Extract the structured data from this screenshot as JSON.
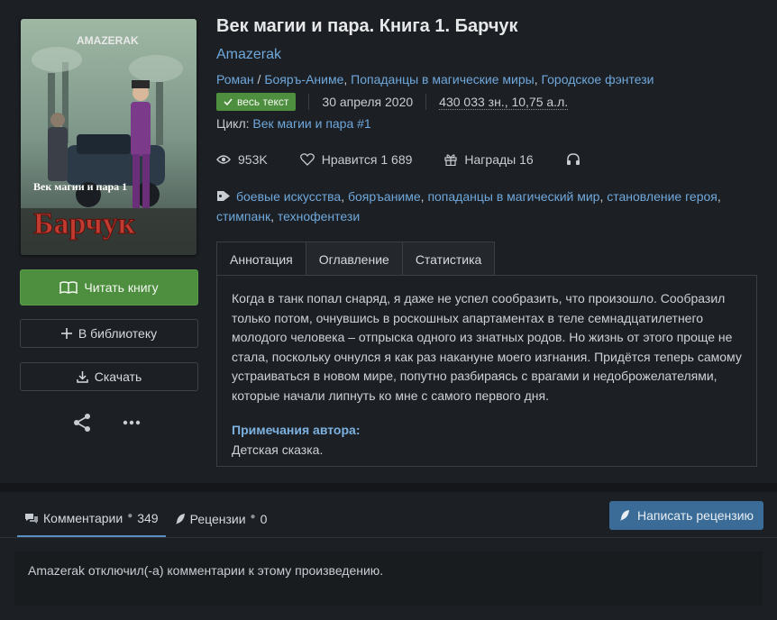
{
  "book": {
    "title": "Век магии и пара. Книга 1. Барчук",
    "author": "Amazerak",
    "genre_main": "Роман",
    "genre_slash": " / ",
    "genres": [
      "Бояръ-Аниме",
      "Попаданцы в магические миры",
      "Городское фэнтези"
    ],
    "status_badge": "весь текст",
    "date": "30 апреля 2020",
    "size": "430 033 зн., 10,75 а.л.",
    "cycle_label": "Цикл: ",
    "cycle": "Век магии и пара #1"
  },
  "cover": {
    "author_text": "AMAZERAK",
    "series_text": "Век магии и пара 1",
    "title_text": "Барчук"
  },
  "stats": {
    "views": "953K",
    "likes": "Нравится 1 689",
    "awards": "Награды 16"
  },
  "tags": [
    "боевые искусства",
    "бояръаниме",
    "попаданцы в магический мир",
    "становление героя",
    "стимпанк",
    "технофентези"
  ],
  "actions": {
    "read": "Читать книгу",
    "library": "В библиотеку",
    "download": "Скачать"
  },
  "tabs": [
    "Аннотация",
    "Оглавление",
    "Статистика"
  ],
  "annotation": {
    "text": "Когда в танк попал снаряд, я даже не успел сообразить, что произошло. Сообразил только потом, очнувшись в роскошных апартаментах в теле семнадцатилетнего молодого человека – отпрыска одного из знатных родов. Но жизнь от этого проще не стала, поскольку очнулся я как раз накануне моего изгнания. Придётся теперь самому устраиваться в новом мире, попутно разбираясь с врагами и недоброжелателями, которые начали липнуть ко мне с самого первого дня.",
    "notes_title": "Примечания автора:",
    "notes": "Детская сказка."
  },
  "comments": {
    "tab_comments": "Комментарии",
    "comments_count": "349",
    "tab_reviews": "Рецензии",
    "reviews_count": "0",
    "write_review": "Написать рецензию",
    "disabled_message": "Amazerak отключил(-а) комментарии к этому произведению."
  },
  "colors": {
    "background": "#1c1f23",
    "link": "#6fa8dc",
    "primary_green": "#4d8f3e",
    "review_button": "#3a6c97"
  }
}
